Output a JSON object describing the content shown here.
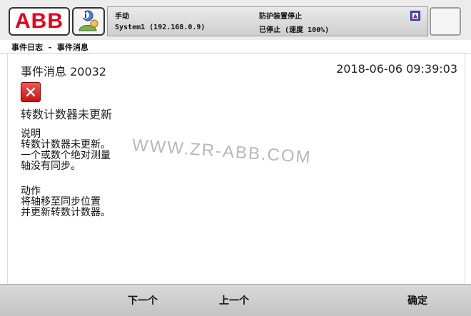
{
  "topbar": {
    "logo_text": "ABB",
    "status": {
      "mode": "手动",
      "system": "System1 (192.168.0.9)",
      "guard_stop": "防护装置停止",
      "stopped": "已停止 (速度 100%)"
    }
  },
  "header": {
    "title": "事件日志 - 事件消息"
  },
  "message": {
    "title": "事件消息 20032",
    "timestamp": "2018-06-06 09:39:03",
    "heading": "转数计数器未更新",
    "description_label": "说明",
    "description_lines": [
      "转数计数器未更新。",
      "一个或数个绝对测量",
      "轴没有同步。"
    ],
    "action_label": "动作",
    "action_lines": [
      "将轴移至同步位置",
      "并更新转数计数器。"
    ]
  },
  "watermark": "WWW.ZR-ABB.COM",
  "buttons": {
    "next": "下一个",
    "previous": "上一个",
    "ok": "确定"
  },
  "colors": {
    "abb_red": "#e2001a",
    "error_red": "#d42020",
    "bar_gray": "#cfcfcf"
  },
  "icons": {
    "user": "user-info-icon",
    "error": "error-x-icon",
    "status": "status-mini-icon"
  }
}
